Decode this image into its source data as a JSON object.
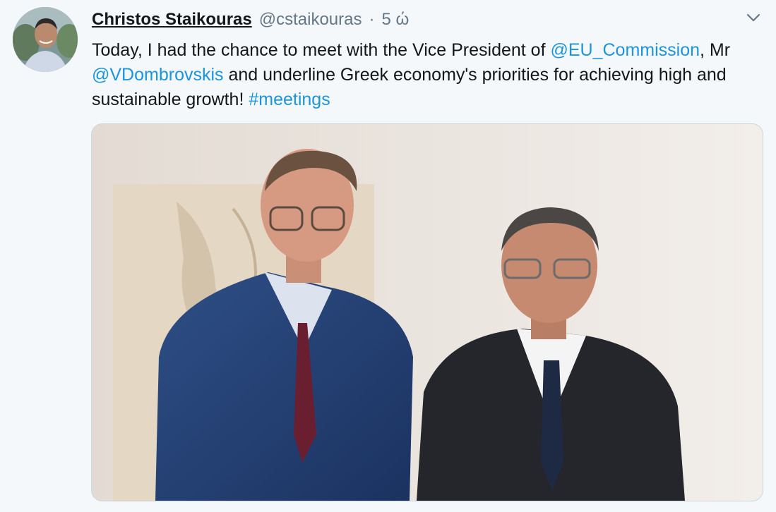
{
  "tweet": {
    "author_name": "Christos Staikouras",
    "author_handle": "@cstaikouras",
    "separator": "·",
    "timestamp": "5 ώ",
    "text_parts": [
      "Today, I had the chance to meet with the Vice President of ",
      "@EU_Commission",
      ", Mr ",
      "@VDombrovskis",
      " and underline Greek economy's priorities for achieving high and sustainable growth! ",
      "#meetings"
    ]
  },
  "icons": {
    "caret": "chevron-down-icon",
    "avatar": "avatar"
  },
  "colors": {
    "link": "#1b95e0",
    "secondary_text": "#657786",
    "background": "#f5f8fa"
  }
}
